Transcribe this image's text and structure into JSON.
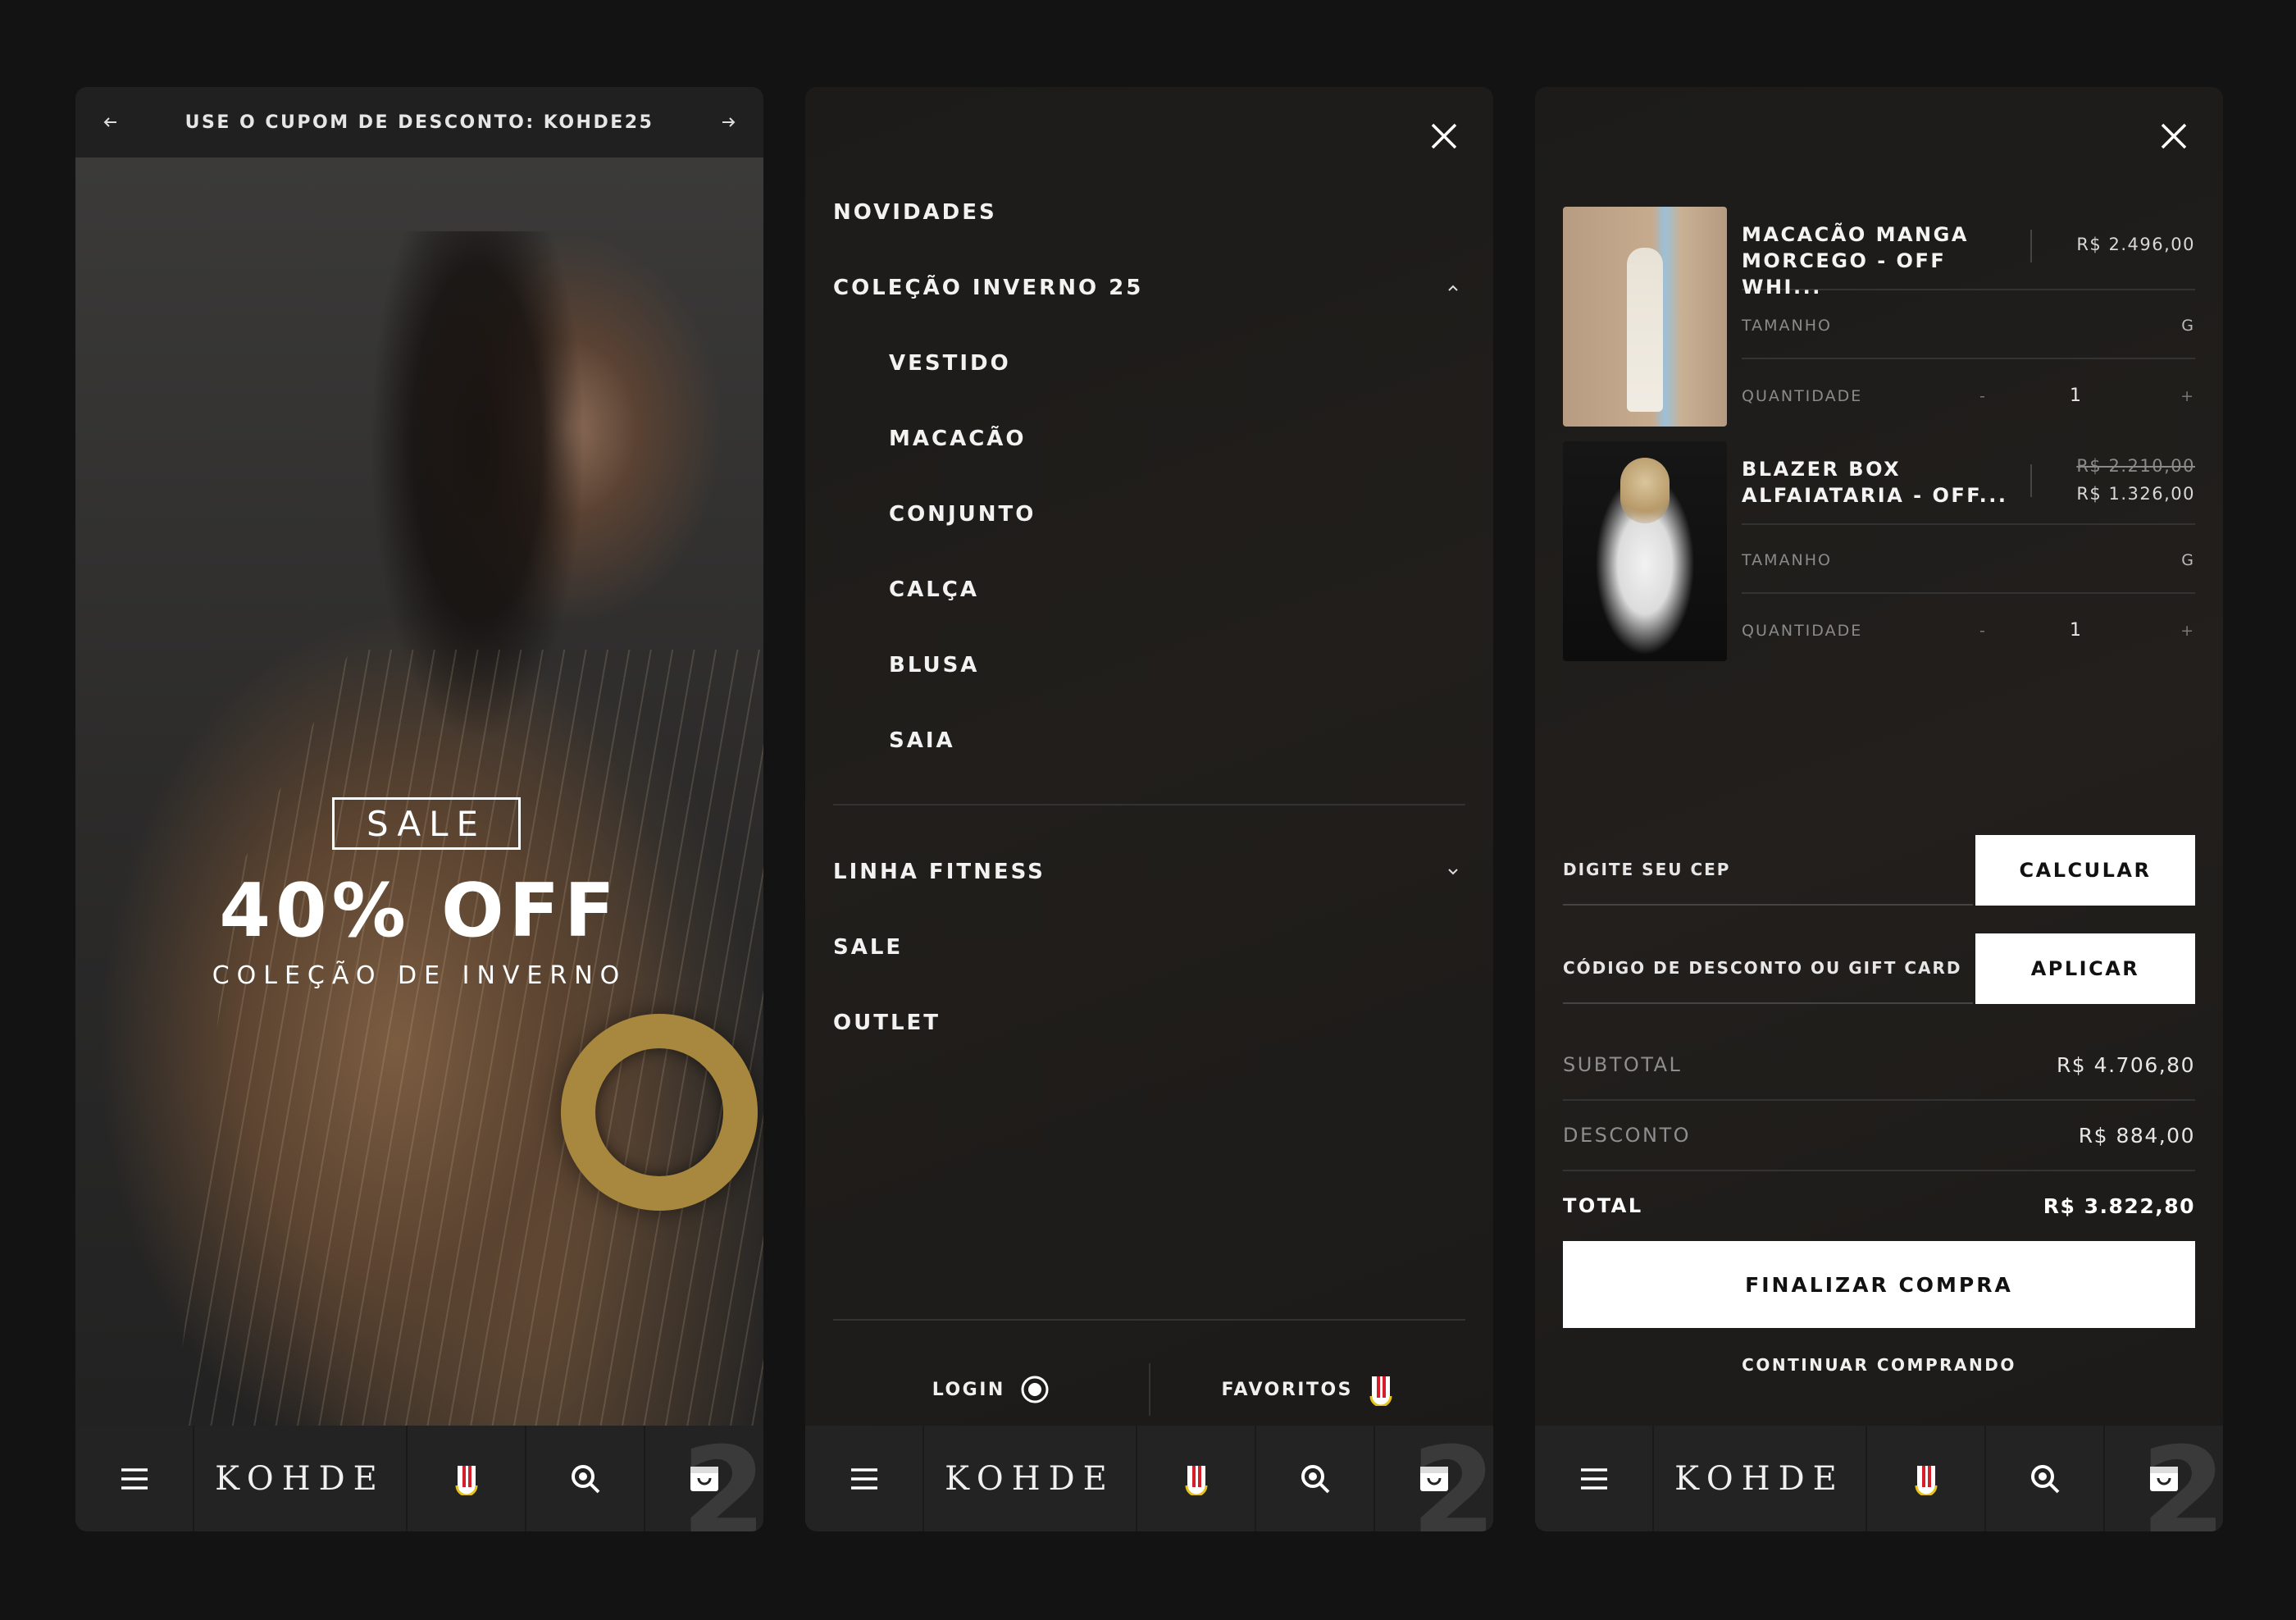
{
  "brand": {
    "logo": "KOHDE"
  },
  "home": {
    "promo": {
      "text": "USE O CUPOM DE DESCONTO: KOHDE25"
    },
    "hero": {
      "badge": "SALE",
      "headline": "40% OFF",
      "subline": "COLEÇÃO DE INVERNO"
    }
  },
  "menu": {
    "items_top": [
      {
        "label": "NOVIDADES"
      },
      {
        "label": "COLEÇÃO INVERNO 25"
      }
    ],
    "subitems": [
      {
        "label": "VESTIDO"
      },
      {
        "label": "MACACÃO"
      },
      {
        "label": "CONJUNTO"
      },
      {
        "label": "CALÇA"
      },
      {
        "label": "BLUSA"
      },
      {
        "label": "SAIA"
      }
    ],
    "items_bottom": [
      {
        "label": "LINHA FITNESS"
      },
      {
        "label": "SALE"
      },
      {
        "label": "OUTLET"
      }
    ],
    "login_label": "LOGIN",
    "favorites_label": "FAVORITOS"
  },
  "cart": {
    "count": "2",
    "items": [
      {
        "name": "MACACÃO MANGA MORCEGO - OFF WHI...",
        "price": "R$ 2.496,00",
        "size_label": "TAMANHO",
        "size": "G",
        "qty_label": "QUANTIDADE",
        "minus": "-",
        "qty": "1",
        "plus": "+"
      },
      {
        "name": "BLAZER BOX ALFAIATARIA - OFF...",
        "old_price": "R$ 2.210,00",
        "price": "R$ 1.326,00",
        "size_label": "TAMANHO",
        "size": "G",
        "qty_label": "QUANTIDADE",
        "minus": "-",
        "qty": "1",
        "plus": "+"
      }
    ],
    "cep_label": "DIGITE SEU CEP",
    "cep_button": "CALCULAR",
    "coupon_label": "CÓDIGO DE DESCONTO OU GIFT CARD",
    "coupon_button": "APLICAR",
    "subtotal_label": "SUBTOTAL",
    "subtotal": "R$ 4.706,80",
    "discount_label": "DESCONTO",
    "discount": "R$ 884,00",
    "total_label": "TOTAL",
    "total": "R$ 3.822,80",
    "checkout": "FINALIZAR COMPRA",
    "continue": "CONTINUAR COMPRANDO"
  }
}
